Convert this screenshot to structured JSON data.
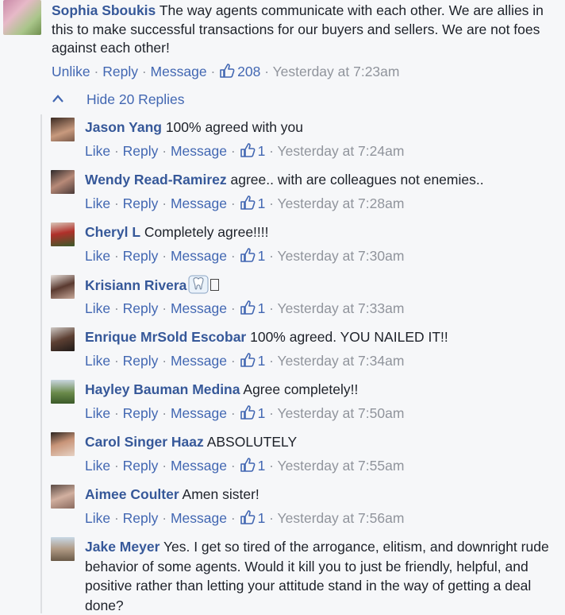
{
  "main_comment": {
    "author": "Sophia Sboukis",
    "text": "The way agents communicate with each other. We are allies in this to make successful transactions for our buyers and sellers. We are not foes against each other!",
    "actions": {
      "unlike": "Unlike",
      "reply": "Reply",
      "message": "Message",
      "like_count": "208",
      "time": "Yesterday at 7:23am"
    }
  },
  "hide_replies_label": "Hide 20 Replies",
  "replies": [
    {
      "author": "Jason Yang",
      "text": "100% agreed with you",
      "like": "Like",
      "reply": "Reply",
      "message": "Message",
      "count": "1",
      "time": "Yesterday at 7:24am"
    },
    {
      "author": "Wendy Read-Ramirez",
      "text": "agree.. with are colleagues not enemies..",
      "like": "Like",
      "reply": "Reply",
      "message": "Message",
      "count": "1",
      "time": "Yesterday at 7:28am"
    },
    {
      "author": "Cheryl L",
      "text": "Completely agree!!!!",
      "like": "Like",
      "reply": "Reply",
      "message": "Message",
      "count": "1",
      "time": "Yesterday at 7:30am"
    },
    {
      "author": "Krisiann Rivera",
      "text": "",
      "like": "Like",
      "reply": "Reply",
      "message": "Message",
      "count": "1",
      "time": "Yesterday at 7:33am"
    },
    {
      "author": "Enrique MrSold Escobar",
      "text": "100% agreed. YOU NAILED IT!!",
      "like": "Like",
      "reply": "Reply",
      "message": "Message",
      "count": "1",
      "time": "Yesterday at 7:34am"
    },
    {
      "author": "Hayley Bauman Medina",
      "text": "Agree completely!!",
      "like": "Like",
      "reply": "Reply",
      "message": "Message",
      "count": "1",
      "time": "Yesterday at 7:50am"
    },
    {
      "author": "Carol Singer Haaz",
      "text": "ABSOLUTELY",
      "like": "Like",
      "reply": "Reply",
      "message": "Message",
      "count": "1",
      "time": "Yesterday at 7:55am"
    },
    {
      "author": "Aimee Coulter",
      "text": "Amen sister!",
      "like": "Like",
      "reply": "Reply",
      "message": "Message",
      "count": "1",
      "time": "Yesterday at 7:56am"
    },
    {
      "author": "Jake Meyer",
      "text": "Yes. I get so tired of the arrogance, elitism, and downright rude behavior of some agents. Would it kill you to just be friendly, helpful, and positive rather than letting your attitude stand in the way of getting a deal done?"
    }
  ],
  "colors": {
    "link": "#365899",
    "action": "#4267b2",
    "muted": "#90949c",
    "background": "#f6f7f9"
  }
}
